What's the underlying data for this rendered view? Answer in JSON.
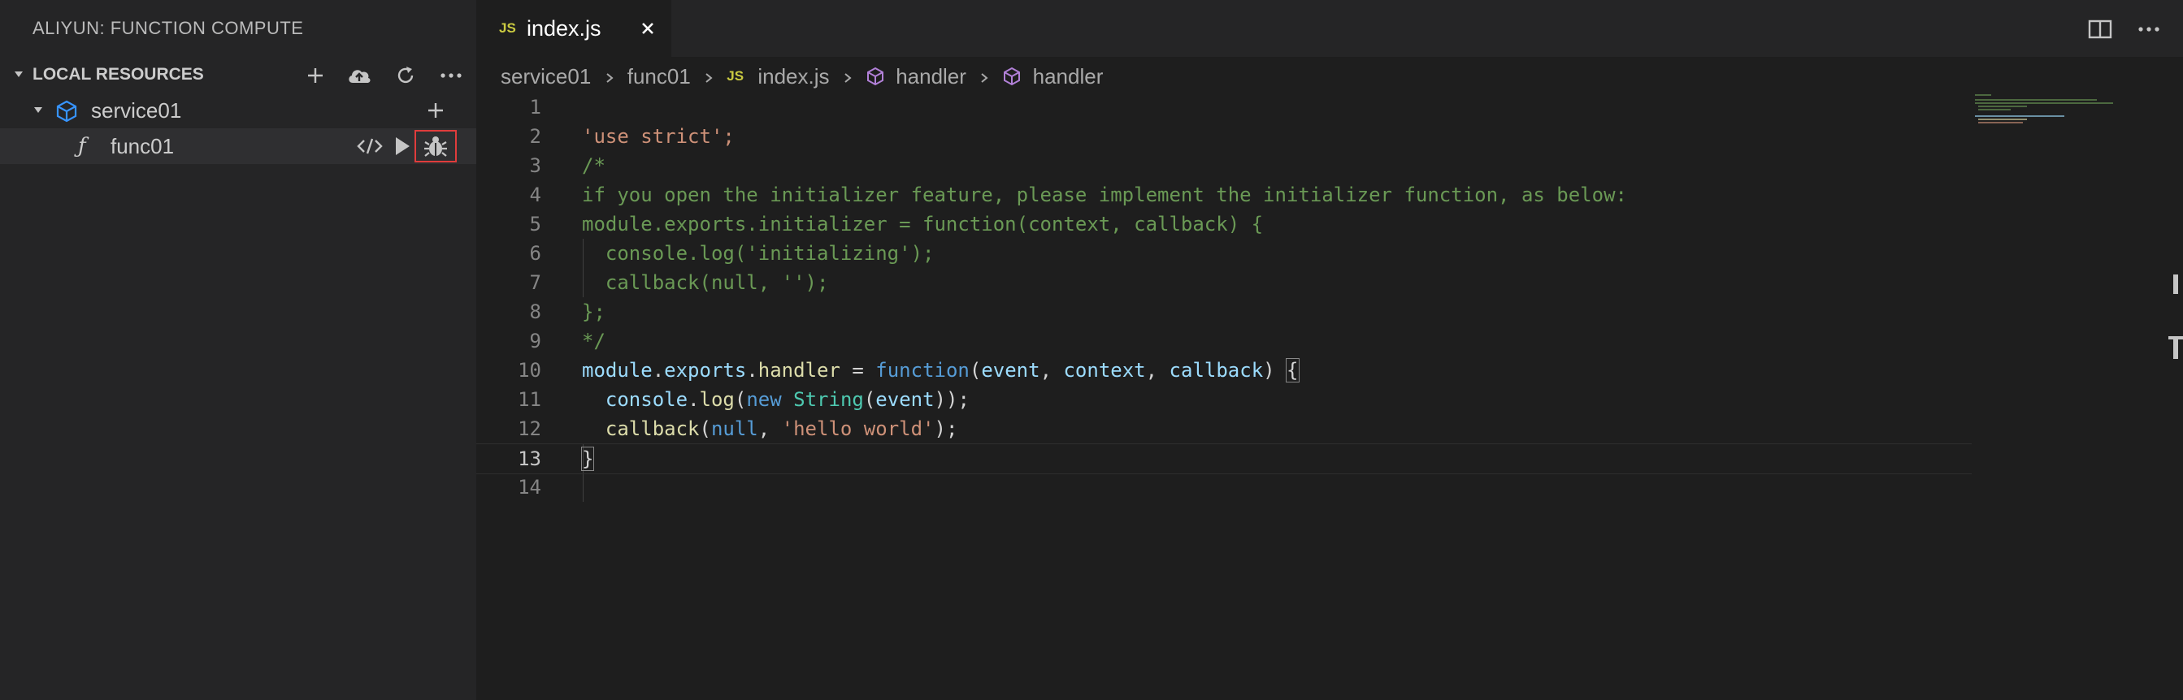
{
  "sidebar": {
    "title": "ALIYUN: FUNCTION COMPUTE",
    "section_title": "LOCAL RESOURCES",
    "service": {
      "label": "service01"
    },
    "function": {
      "icon_glyph": "ƒ",
      "label": "func01"
    }
  },
  "tab": {
    "badge": "JS",
    "label": "index.js"
  },
  "breadcrumb": {
    "items": [
      "service01",
      "func01",
      "index.js",
      "handler",
      "handler"
    ],
    "file_badge": "JS"
  },
  "editor": {
    "active_line": 13,
    "lines": [
      {
        "n": "1"
      },
      {
        "n": "2"
      },
      {
        "n": "3"
      },
      {
        "n": "4"
      },
      {
        "n": "5"
      },
      {
        "n": "6"
      },
      {
        "n": "7"
      },
      {
        "n": "8"
      },
      {
        "n": "9"
      },
      {
        "n": "10"
      },
      {
        "n": "11"
      },
      {
        "n": "12"
      },
      {
        "n": "13"
      },
      {
        "n": "14"
      }
    ],
    "code": {
      "l2": "'use strict';",
      "l3": "/*",
      "l4": "if you open the initializer feature, please implement the initializer function, as below:",
      "l5": "module.exports.initializer = function(context, callback) {",
      "l6": "  console.log('initializing');",
      "l7": "  callback(null, '');",
      "l8": "};",
      "l9": "*/",
      "l10": {
        "module": "module",
        "d1": ".",
        "exports": "exports",
        "d2": ".",
        "handler": "handler",
        "eq": " = ",
        "function": "function",
        "p1": "(",
        "event": "event",
        "c1": ", ",
        "context": "context",
        "c2": ", ",
        "callback": "callback",
        "p2": ") ",
        "brace": "{"
      },
      "l11": {
        "indent": "  ",
        "console": "console",
        "dot": ".",
        "log": "log",
        "p1": "(",
        "new": "new",
        "sp": " ",
        "String": "String",
        "p2": "(",
        "event": "event",
        "p3": "));"
      },
      "l12": {
        "indent": "  ",
        "callback": "callback",
        "p1": "(",
        "null": "null",
        "c": ", ",
        "str": "'hello world'",
        "end": ");"
      },
      "l13": "}"
    }
  },
  "colors": {
    "accent_red": "#e03c3c",
    "js_badge": "#cbcb41",
    "cube_blue": "#3794ff",
    "symbol_purple": "#b180d7"
  }
}
